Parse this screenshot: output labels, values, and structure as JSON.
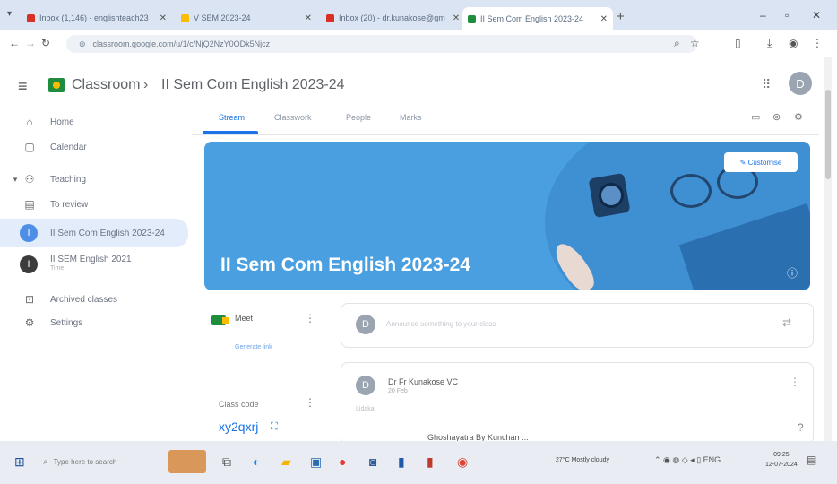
{
  "browser": {
    "tabs": [
      {
        "title": "Inbox (1,146) - englishteach23",
        "color": "#d93025",
        "active": false
      },
      {
        "title": "V SEM 2023-24",
        "color": "#fbbc04",
        "active": false
      },
      {
        "title": "Inbox (20) - dr.kunakose@gm",
        "color": "#d93025",
        "active": false
      },
      {
        "title": "II Sem Com English 2023-24",
        "color": "#1e8e3e",
        "active": true
      }
    ],
    "url": "classroom.google.com/u/1/c/NjQ2NzY0ODk5Njcz",
    "new_tab": "+"
  },
  "header": {
    "app_name": "Classroom",
    "separator": "›",
    "class_name": "II Sem Com English 2023-24",
    "avatar": "D"
  },
  "sidebar": {
    "items": [
      {
        "label": "Home",
        "icon": "⌂"
      },
      {
        "label": "Calendar",
        "icon": "▢"
      },
      {
        "label": "Teaching",
        "icon": "👥"
      },
      {
        "label": "To review",
        "icon": "▤"
      },
      {
        "label": "II Sem Com English 2023-24",
        "dot": "I",
        "color": "#4f8ee6"
      },
      {
        "label": "II SEM English 2021",
        "sub": "Time",
        "dot": "I",
        "color": "#3c3c3c"
      },
      {
        "label": "Archived classes",
        "icon": "⊡"
      },
      {
        "label": "Settings",
        "icon": "⚙"
      }
    ]
  },
  "tabs": [
    "Stream",
    "Classwork",
    "People",
    "Marks"
  ],
  "banner": {
    "title": "II Sem Com English 2023-24",
    "customise": "✎ Customise"
  },
  "meet": {
    "label": "Meet",
    "link": "Generate link"
  },
  "class_code": {
    "label": "Class code",
    "value": "xy2qxrj"
  },
  "stream": {
    "announce_placeholder": "Announce something to your class",
    "post_author": "Dr Fr Kunakose VC",
    "post_date": "20 Feb",
    "post_text": "Lidaka",
    "post_file": "Ghoshayatra By Kunchan ..."
  },
  "taskbar": {
    "search": "Type here to search",
    "weather": "27°C  Mostly cloudy",
    "lang": "ENG",
    "time": "09:25",
    "date": "12-07-2024"
  }
}
